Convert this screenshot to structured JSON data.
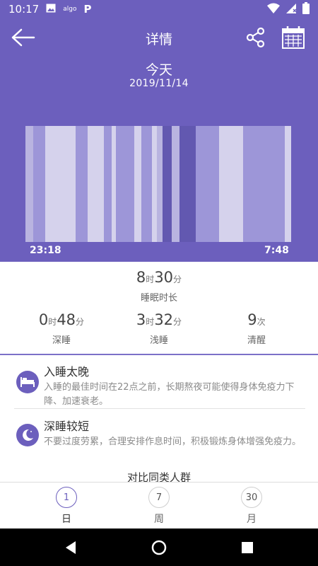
{
  "status_bar": {
    "time": "10:17",
    "icons": [
      "image-icon",
      "algo-icon",
      "parking-icon",
      "wifi-icon",
      "no-signal-icon",
      "battery-icon"
    ],
    "algo_text": "algo",
    "parking_text": "P"
  },
  "header": {
    "title": "详情",
    "back_icon": "arrow-left-icon",
    "share_icon": "share-icon",
    "calendar_icon": "calendar-icon",
    "date_label": "今天",
    "date": "2019/11/14",
    "colors": {
      "background": "#6c5fbd",
      "deep": "#6258b0",
      "light": "#9d96d8",
      "rem": "#b9b4e0",
      "awake": "#d5d2ec"
    }
  },
  "chart_data": {
    "type": "sleep-stage-timeline",
    "start_time": "23:18",
    "end_time": "7:48",
    "segments": [
      {
        "stage": "rem",
        "share": 0.03
      },
      {
        "stage": "light",
        "share": 0.045
      },
      {
        "stage": "awake",
        "share": 0.115
      },
      {
        "stage": "light",
        "share": 0.045
      },
      {
        "stage": "awake",
        "share": 0.06
      },
      {
        "stage": "light",
        "share": 0.03
      },
      {
        "stage": "awake",
        "share": 0.015
      },
      {
        "stage": "light",
        "share": 0.07
      },
      {
        "stage": "awake",
        "share": 0.025
      },
      {
        "stage": "light",
        "share": 0.04
      },
      {
        "stage": "awake",
        "share": 0.02
      },
      {
        "stage": "rem",
        "share": 0.02
      },
      {
        "stage": "deep",
        "share": 0.035
      },
      {
        "stage": "rem",
        "share": 0.03
      },
      {
        "stage": "deep",
        "share": 0.06
      },
      {
        "stage": "light",
        "share": 0.09
      },
      {
        "stage": "awake",
        "share": 0.09
      },
      {
        "stage": "light",
        "share": 0.155
      },
      {
        "stage": "awake",
        "share": 0.025
      }
    ]
  },
  "summary": {
    "total_hours": "8",
    "hour_unit": "时",
    "total_minutes": "30",
    "minute_unit": "分",
    "total_label": "睡眠时长",
    "deep": {
      "hours": "0",
      "hour_unit": "时",
      "minutes": "48",
      "minute_unit": "分",
      "label": "深睡"
    },
    "light": {
      "hours": "3",
      "hour_unit": "时",
      "minutes": "32",
      "minute_unit": "分",
      "label": "浅睡"
    },
    "awake": {
      "count": "9",
      "count_unit": "次",
      "label": "清醒"
    }
  },
  "tips": [
    {
      "icon": "bed-icon",
      "title": "入睡太晚",
      "text": "入睡的最佳时间在22点之前，长期熬夜可能使得身体免疫力下降、加速衰老。"
    },
    {
      "icon": "moon-icon",
      "title": "深睡较短",
      "text": "不要过度劳累，合理安排作息时间，积极锻炼身体增强免疫力。"
    }
  ],
  "compare_title": "对比同类人群",
  "tabs": [
    {
      "number": "1",
      "label": "日",
      "active": true
    },
    {
      "number": "7",
      "label": "周",
      "active": false
    },
    {
      "number": "30",
      "label": "月",
      "active": false
    }
  ],
  "nav_bar": {
    "icons": [
      "back-triangle-icon",
      "home-circle-icon",
      "recents-square-icon"
    ]
  }
}
